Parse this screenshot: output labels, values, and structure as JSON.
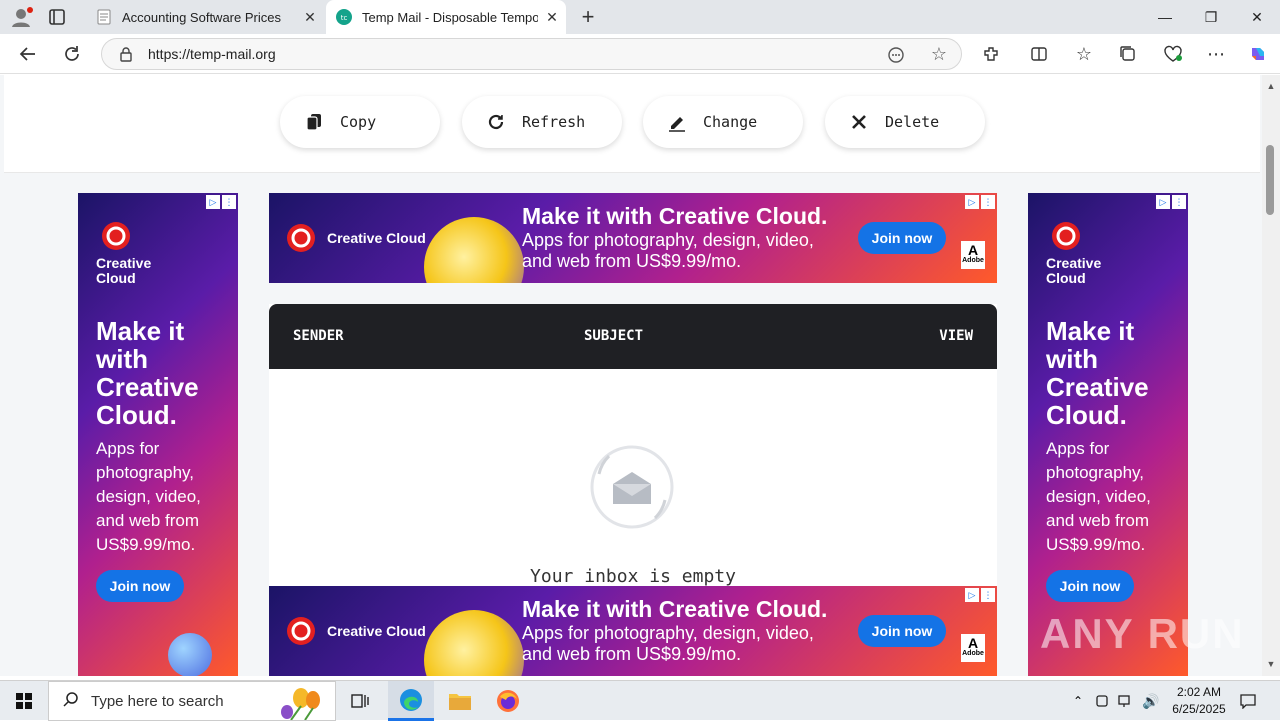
{
  "browser": {
    "tabs": [
      {
        "title": "Accounting Software Prices",
        "active": false
      },
      {
        "title": "Temp Mail - Disposable Temporar",
        "active": true
      }
    ],
    "url": "https://temp-mail.org"
  },
  "actions": {
    "copy": "Copy",
    "refresh": "Refresh",
    "change": "Change",
    "delete": "Delete"
  },
  "inbox": {
    "col_sender": "SENDER",
    "col_subject": "SUBJECT",
    "col_view": "VIEW",
    "empty_text": "Your inbox is empty"
  },
  "ads": {
    "brand": "Creative Cloud",
    "brand_line1": "Creative",
    "brand_line2": "Cloud",
    "headline": "Make it with Creative Cloud.",
    "sky_headline": "Make it with Creative Cloud.",
    "banner_body": "Apps for photography, design, video, and web from US$9.99/mo.",
    "sky_body": "Apps for photography, design, video, and web from US$9.99/mo.",
    "cta": "Join now",
    "adobe": "Adobe"
  },
  "taskbar": {
    "search_placeholder": "Type here to search",
    "time": "2:02 AM",
    "date": "6/25/2025"
  },
  "watermark": "ANY RUN",
  "colors": {
    "accent": "#1473e6",
    "inbox_header": "#1f2024",
    "adobe_red": "#e32020"
  }
}
